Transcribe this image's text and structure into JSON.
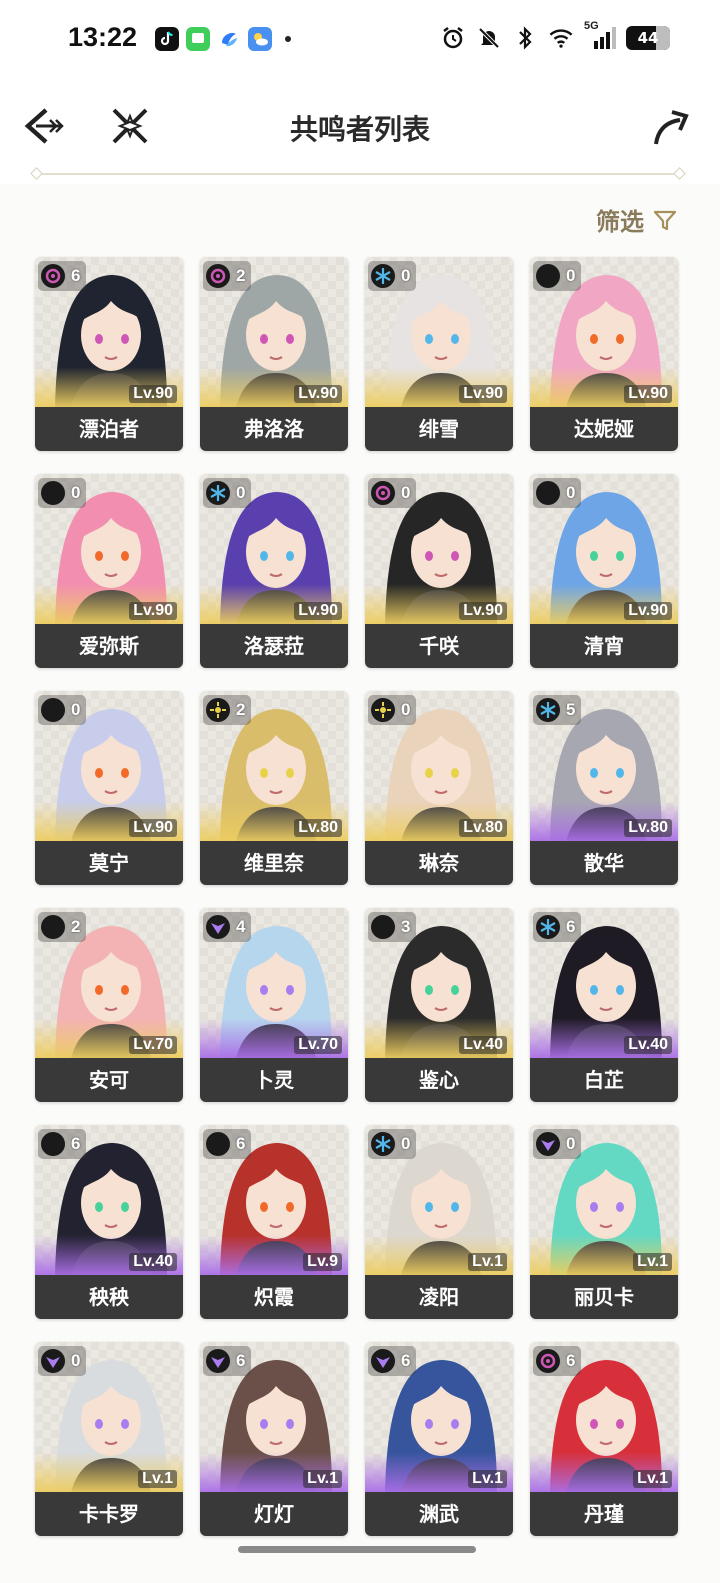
{
  "status_bar": {
    "time": "13:22",
    "battery": "44",
    "network": "5G",
    "notification_apps": [
      "tiktok-icon",
      "messages-icon",
      "browser-icon",
      "weather-icon"
    ],
    "system_icons": [
      "alarm-icon",
      "mute-icon",
      "bluetooth-icon",
      "wifi-icon",
      "signal-icon",
      "battery-icon"
    ]
  },
  "header": {
    "title": "共鸣者列表",
    "back_icon": "back-arrow-icon",
    "tool_icon": "crossed-swords-icon",
    "share_icon": "share-arrow-icon"
  },
  "filter": {
    "label": "筛选",
    "icon": "filter-funnel-icon"
  },
  "element_colors": {
    "havoc": "#d056b6",
    "glacio": "#52b7e8",
    "fusion": "#f26a2a",
    "aero": "#46d29a",
    "spectro": "#e8d24a",
    "electro": "#a97cf0"
  },
  "rarity_colors": {
    "gold": "#ecd060",
    "purple": "#a96ee6"
  },
  "characters": [
    {
      "name": "漂泊者",
      "level": "Lv.90",
      "sequence": "6",
      "element": "havoc",
      "rarity": "gold",
      "hair": "#1f2430"
    },
    {
      "name": "弗洛洛",
      "level": "Lv.90",
      "sequence": "2",
      "element": "havoc",
      "rarity": "gold",
      "hair": "#9ea6a6"
    },
    {
      "name": "绯雪",
      "level": "Lv.90",
      "sequence": "0",
      "element": "glacio",
      "rarity": "gold",
      "hair": "#e6e3e2"
    },
    {
      "name": "达妮娅",
      "level": "Lv.90",
      "sequence": "0",
      "element": "fusion",
      "rarity": "gold",
      "hair": "#f1a7c4"
    },
    {
      "name": "爱弥斯",
      "level": "Lv.90",
      "sequence": "0",
      "element": "fusion",
      "rarity": "gold",
      "hair": "#f28fb0"
    },
    {
      "name": "洛瑟菈",
      "level": "Lv.90",
      "sequence": "0",
      "element": "glacio",
      "rarity": "gold",
      "hair": "#5a3fae"
    },
    {
      "name": "千咲",
      "level": "Lv.90",
      "sequence": "0",
      "element": "havoc",
      "rarity": "gold",
      "hair": "#262626"
    },
    {
      "name": "清宵",
      "level": "Lv.90",
      "sequence": "0",
      "element": "aero",
      "rarity": "gold",
      "hair": "#6ea5e6"
    },
    {
      "name": "莫宁",
      "level": "Lv.90",
      "sequence": "0",
      "element": "fusion",
      "rarity": "gold",
      "hair": "#c7cdeb"
    },
    {
      "name": "维里奈",
      "level": "Lv.80",
      "sequence": "2",
      "element": "spectro",
      "rarity": "gold",
      "hair": "#d9bd6a"
    },
    {
      "name": "琳奈",
      "level": "Lv.80",
      "sequence": "0",
      "element": "spectro",
      "rarity": "gold",
      "hair": "#ead3bb"
    },
    {
      "name": "散华",
      "level": "Lv.80",
      "sequence": "5",
      "element": "glacio",
      "rarity": "purple",
      "hair": "#a7a7b2"
    },
    {
      "name": "安可",
      "level": "Lv.70",
      "sequence": "2",
      "element": "fusion",
      "rarity": "gold",
      "hair": "#f3b3b5"
    },
    {
      "name": "卜灵",
      "level": "Lv.70",
      "sequence": "4",
      "element": "electro",
      "rarity": "purple",
      "hair": "#b6d6ee"
    },
    {
      "name": "鉴心",
      "level": "Lv.40",
      "sequence": "3",
      "element": "aero",
      "rarity": "gold",
      "hair": "#2b2b2b"
    },
    {
      "name": "白芷",
      "level": "Lv.40",
      "sequence": "6",
      "element": "glacio",
      "rarity": "purple",
      "hair": "#1e1b24"
    },
    {
      "name": "秧秧",
      "level": "Lv.40",
      "sequence": "6",
      "element": "aero",
      "rarity": "purple",
      "hair": "#222230"
    },
    {
      "name": "炽霞",
      "level": "Lv.9",
      "sequence": "6",
      "element": "fusion",
      "rarity": "purple",
      "hair": "#b8322c"
    },
    {
      "name": "凌阳",
      "level": "Lv.1",
      "sequence": "0",
      "element": "glacio",
      "rarity": "gold",
      "hair": "#dcd8d0"
    },
    {
      "name": "丽贝卡",
      "level": "Lv.1",
      "sequence": "0",
      "element": "electro",
      "rarity": "gold",
      "hair": "#63d8c2"
    },
    {
      "name": "卡卡罗",
      "level": "Lv.1",
      "sequence": "0",
      "element": "electro",
      "rarity": "gold",
      "hair": "#d8dcdf"
    },
    {
      "name": "灯灯",
      "level": "Lv.1",
      "sequence": "6",
      "element": "electro",
      "rarity": "purple",
      "hair": "#6a5048"
    },
    {
      "name": "渊武",
      "level": "Lv.1",
      "sequence": "6",
      "element": "electro",
      "rarity": "purple",
      "hair": "#36559c"
    },
    {
      "name": "丹瑾",
      "level": "Lv.1",
      "sequence": "6",
      "element": "havoc",
      "rarity": "purple",
      "hair": "#d8303a"
    }
  ]
}
